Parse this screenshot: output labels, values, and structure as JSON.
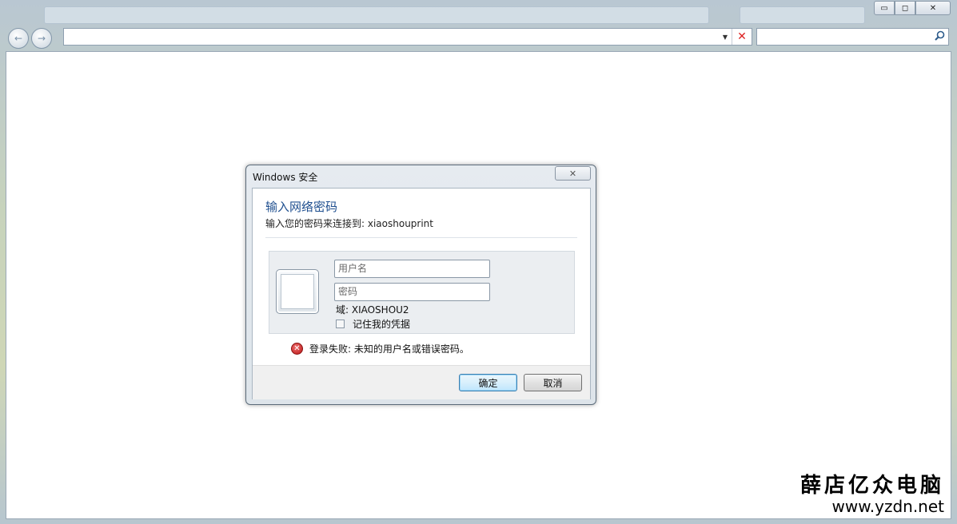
{
  "browser": {
    "window_buttons": {
      "minimize": "▭",
      "maximize": "◻",
      "close": "✕"
    },
    "nav": {
      "back": "←",
      "forward": "→"
    },
    "address": {
      "value": "",
      "dropdown": "▼",
      "stop": "✕"
    },
    "search": {
      "value": "",
      "icon": "search-icon"
    }
  },
  "dialog": {
    "title": "Windows 安全",
    "close_glyph": "✕",
    "heading": "输入网络密码",
    "subtext": "输入您的密码来连接到: xiaoshouprint",
    "username_placeholder": "用户名",
    "password_placeholder": "密码",
    "domain": "域: XIAOSHOU2",
    "remember_label": "记住我的凭据",
    "error_text": "登录失败: 未知的用户名或错误密码。",
    "ok_label": "确定",
    "cancel_label": "取消",
    "colors": {
      "heading": "#1f4f8f",
      "ok_border": "#3c7fb1"
    }
  },
  "watermark": {
    "chinese": "薛店亿众电脑",
    "url": "www.yzdn.net"
  }
}
